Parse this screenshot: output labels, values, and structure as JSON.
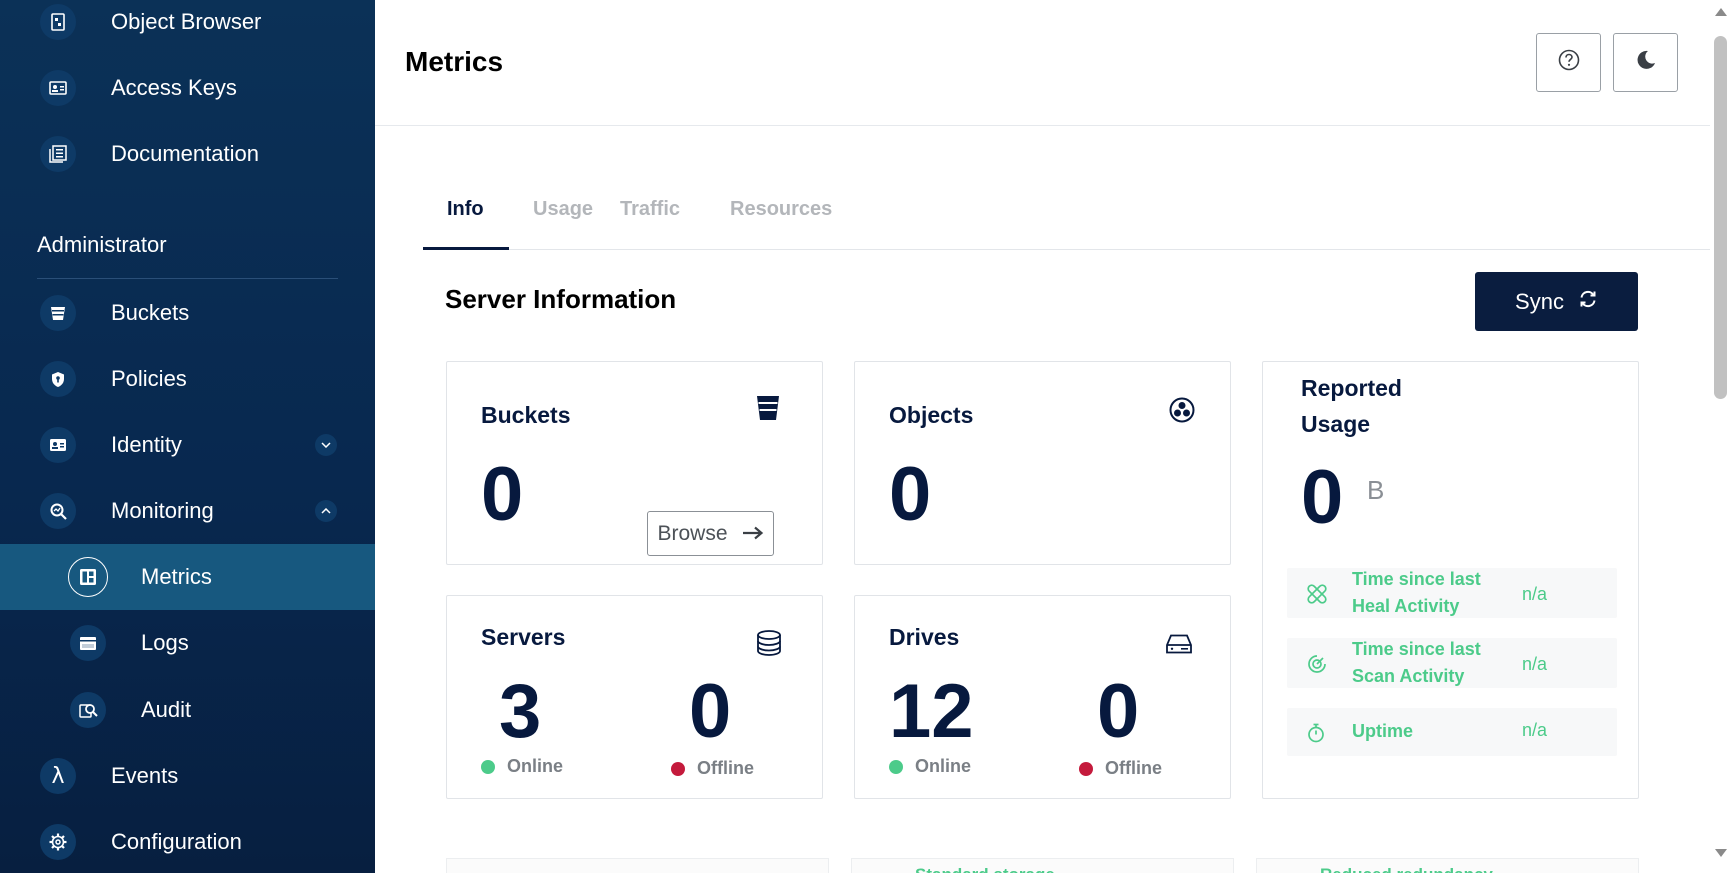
{
  "sidebar": {
    "top_items": [
      {
        "label": "Object Browser",
        "icon": "object-browser-icon"
      },
      {
        "label": "Access Keys",
        "icon": "access-keys-icon"
      },
      {
        "label": "Documentation",
        "icon": "documentation-icon"
      }
    ],
    "section_title": "Administrator",
    "items": {
      "buckets": "Buckets",
      "policies": "Policies",
      "identity": "Identity",
      "monitoring": "Monitoring",
      "metrics": "Metrics",
      "logs": "Logs",
      "audit": "Audit",
      "events": "Events",
      "configuration": "Configuration"
    },
    "events_glyph": "λ"
  },
  "header": {
    "title": "Metrics",
    "help_icon": "help-circle-icon",
    "theme_icon": "moon-icon"
  },
  "tabs": [
    {
      "label": "Info",
      "active": true
    },
    {
      "label": "Usage",
      "active": false
    },
    {
      "label": "Traffic",
      "active": false
    },
    {
      "label": "Resources",
      "active": false
    }
  ],
  "server_info": {
    "heading": "Server Information",
    "sync_label": "Sync",
    "buckets": {
      "title": "Buckets",
      "value": "0",
      "browse_label": "Browse"
    },
    "objects": {
      "title": "Objects",
      "value": "0"
    },
    "servers": {
      "title": "Servers",
      "online": "3",
      "offline": "0",
      "online_label": "Online",
      "offline_label": "Offline"
    },
    "drives": {
      "title": "Drives",
      "online": "12",
      "offline": "0",
      "online_label": "Online",
      "offline_label": "Offline"
    },
    "usage": {
      "title_line1": "Reported",
      "title_line2": "Usage",
      "value": "0",
      "unit": "B",
      "rows": [
        {
          "label_line1": "Time since last",
          "label_line2": "Heal Activity",
          "value": "n/a"
        },
        {
          "label_line1": "Time since last",
          "label_line2": "Scan Activity",
          "value": "n/a"
        },
        {
          "label_line1": "Uptime",
          "label_line2": "",
          "value": "n/a"
        }
      ]
    },
    "bottom_cards": [
      "",
      "Standard storage",
      "Reduced redundancy"
    ]
  },
  "colors": {
    "sidebar_bg": "#0b3157",
    "active_nav": "#17587f",
    "brand_navy": "#07193e",
    "online": "#4ccb8a",
    "offline": "#c41a3c",
    "accent_green": "#4ccb8a"
  }
}
